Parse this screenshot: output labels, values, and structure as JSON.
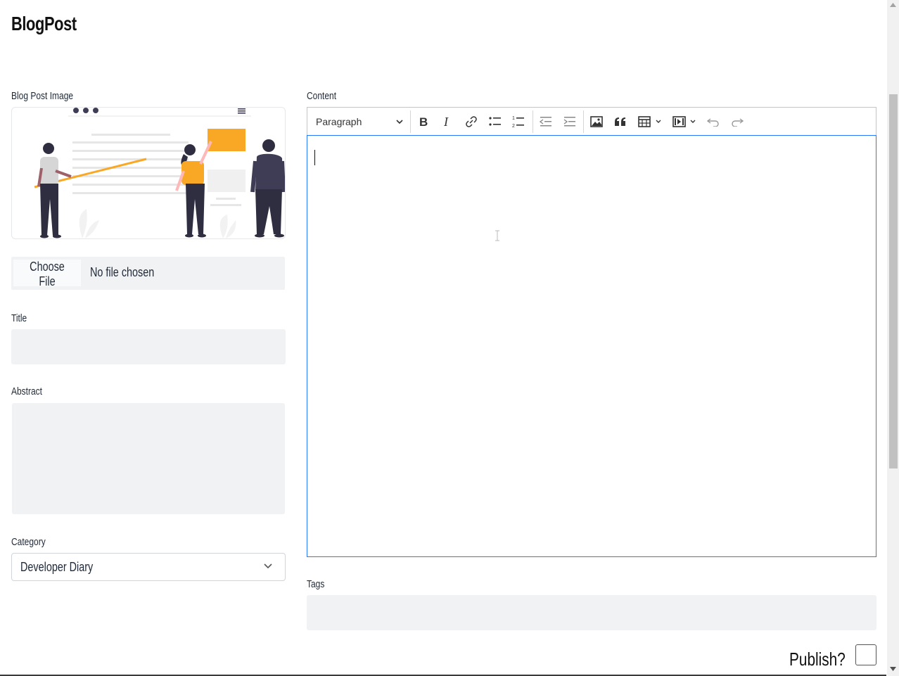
{
  "page": {
    "title": "BlogPost"
  },
  "image_field": {
    "label": "Blog Post Image",
    "choose_label": "Choose File",
    "status": "No file chosen"
  },
  "title_field": {
    "label": "Title",
    "value": ""
  },
  "abstract_field": {
    "label": "Abstract",
    "value": ""
  },
  "category_field": {
    "label": "Category",
    "selected": "Developer Diary"
  },
  "content_field": {
    "label": "Content",
    "toolbar": {
      "heading_select": "Paragraph",
      "buttons": [
        "bold-icon",
        "italic-icon",
        "link-icon",
        "bulleted-list-icon",
        "numbered-list-icon",
        "outdent-icon",
        "indent-icon",
        "image-icon",
        "blockquote-icon",
        "table-icon",
        "media-icon",
        "undo-icon",
        "redo-icon"
      ]
    },
    "value": ""
  },
  "tags_field": {
    "label": "Tags",
    "value": ""
  },
  "publish": {
    "label": "Publish?",
    "checked": false
  },
  "colors": {
    "accent": "#f9a826",
    "dark": "#2f2e41",
    "focus": "#2977ff",
    "field_bg": "#f1f2f4"
  }
}
